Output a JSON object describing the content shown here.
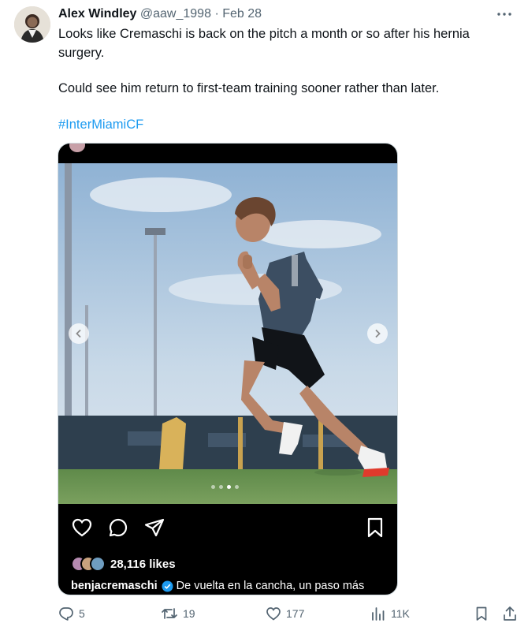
{
  "tweet": {
    "author_name": "Alex Windley",
    "handle": "@aaw_1998",
    "separator": "·",
    "date": "Feb 28",
    "text_line1": "Looks like Cremaschi is back on the pitch a month or so after his hernia surgery.",
    "text_line2": "Could see him return to first-team training sooner rather than later.",
    "hashtag": "#InterMiamiCF"
  },
  "embed": {
    "likes": "28,116 likes",
    "caption_user": "benjacremaschi",
    "caption_text": "De vuelta en la cancha, un paso más",
    "carousel_index": 3,
    "carousel_total": 4
  },
  "actions": {
    "replies": "5",
    "retweets": "19",
    "likes": "177",
    "views": "11K"
  },
  "colors": {
    "link": "#1d9bf0",
    "muted": "#536471",
    "text": "#0f1419"
  }
}
